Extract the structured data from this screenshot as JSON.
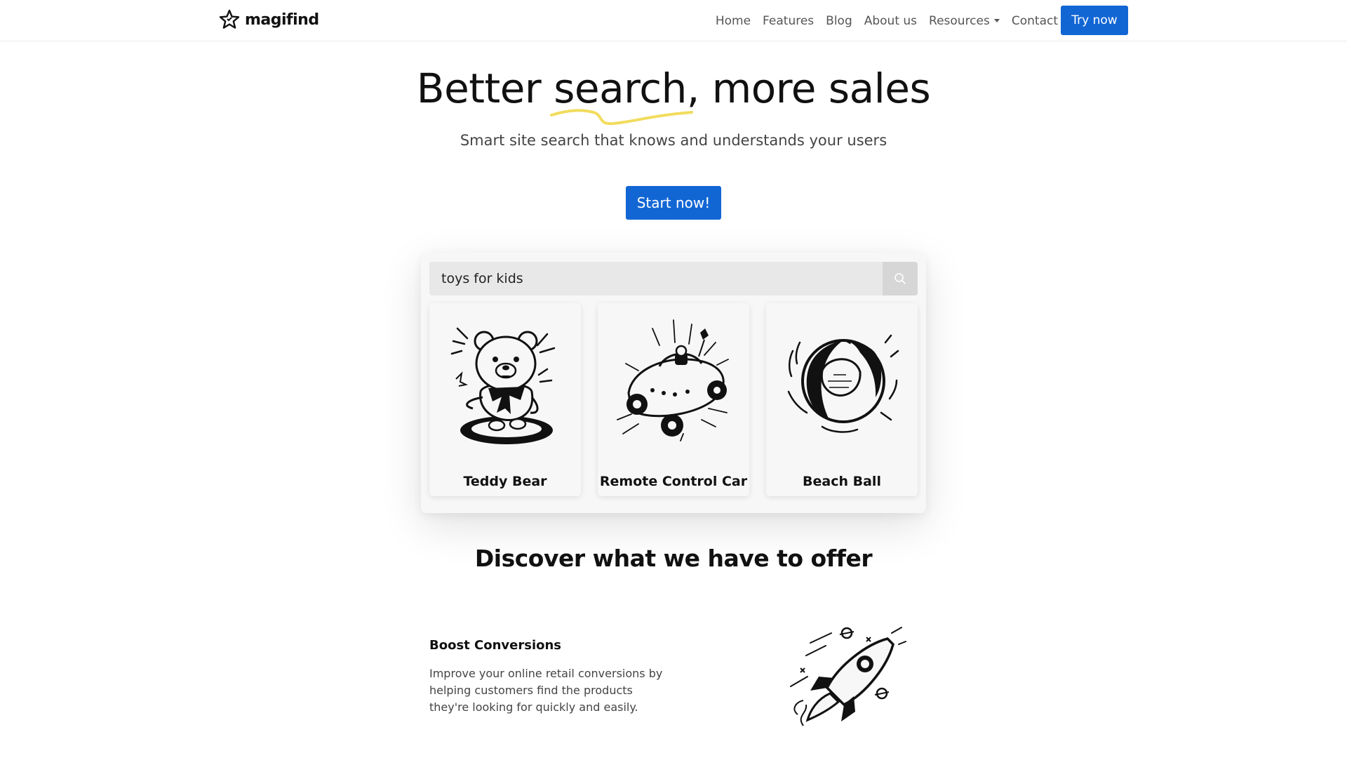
{
  "navbar": {
    "brand": "magifind",
    "links": [
      {
        "label": "Home"
      },
      {
        "label": "Features"
      },
      {
        "label": "Blog"
      },
      {
        "label": "About us"
      },
      {
        "label": "Resources",
        "has_dropdown": true
      },
      {
        "label": "Contact"
      }
    ],
    "cta_label": "Try now"
  },
  "hero": {
    "title_before": "Better ",
    "title_highlight": "search,",
    "title_after": " more sales",
    "subtitle": "Smart site search that knows and understands your users",
    "cta_label": "Start now!"
  },
  "demo": {
    "search_value": "toys for kids",
    "results": [
      {
        "name": "Teddy Bear"
      },
      {
        "name": "Remote Control Car"
      },
      {
        "name": "Beach Ball"
      }
    ]
  },
  "discover": {
    "title": "Discover what we have to offer",
    "feature": {
      "title": "Boost Conversions",
      "description": "Improve your online retail conversions by helping customers find the products they're looking for quickly and easily."
    }
  },
  "colors": {
    "accent": "#1266d4",
    "highlight_underline": "#f2dc5d"
  },
  "icons": [
    "star-logo-icon",
    "search-icon",
    "chevron-down-icon",
    "teddy-bear-illustration",
    "rc-car-illustration",
    "beach-ball-illustration",
    "rocket-illustration"
  ]
}
